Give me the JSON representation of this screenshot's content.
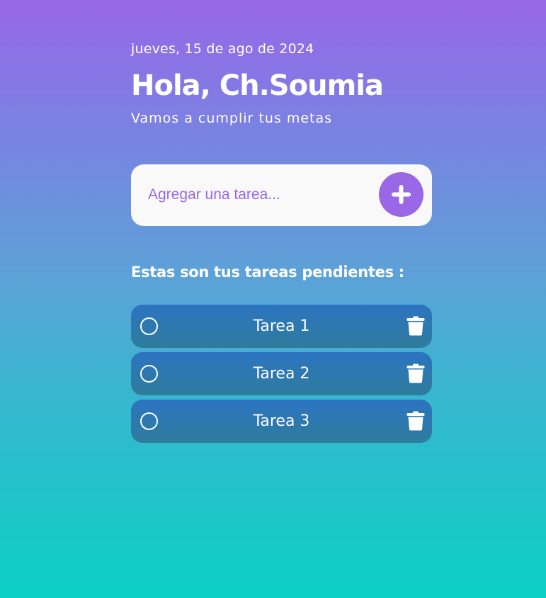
{
  "header": {
    "date": "jueves, 15 de ago de 2024",
    "greeting": "Hola, Ch.Soumia",
    "subtitle": "Vamos a cumplir tus metas"
  },
  "add_task": {
    "placeholder": "Agregar una tarea...",
    "value": "",
    "button_icon": "plus-icon"
  },
  "tasks_section": {
    "title": "Estas son tus tareas pendientes :",
    "items": [
      {
        "label": "Tarea 1",
        "done": false
      },
      {
        "label": "Tarea 2",
        "done": false
      },
      {
        "label": "Tarea 3",
        "done": false
      }
    ]
  },
  "icons": {
    "check": "circle-checkbox-icon",
    "delete": "trash-icon"
  },
  "colors": {
    "gradient_top": "#9867e8",
    "gradient_bottom": "#0bd0c6",
    "accent": "#9a67e6",
    "task_bg_top": "#2c74c1",
    "task_bg_bottom": "#2e7c9c",
    "input_bg": "#f9f9f9"
  }
}
